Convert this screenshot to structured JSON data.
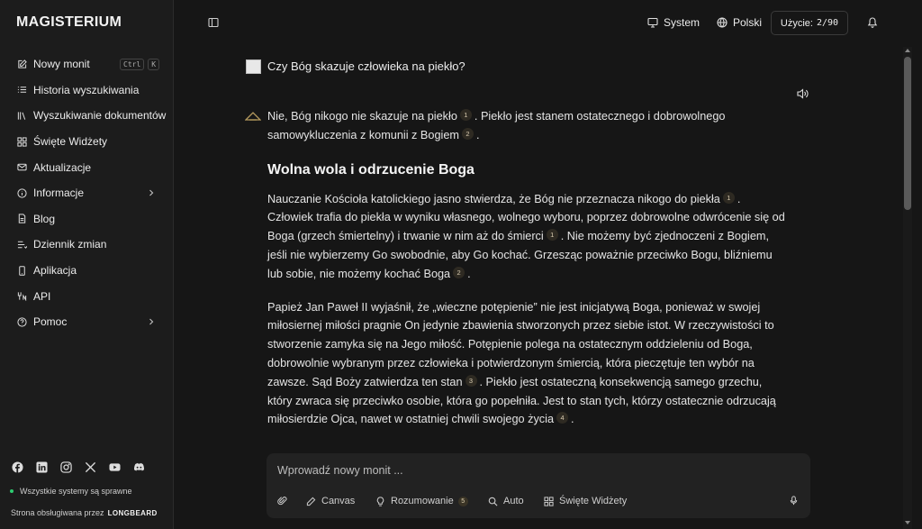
{
  "app": {
    "logo": "MAGISTERIUM"
  },
  "sidebar": {
    "items": [
      {
        "label": "Nowy monit",
        "icon": "edit-icon",
        "shortcut": [
          "Ctrl",
          "K"
        ]
      },
      {
        "label": "Historia wyszukiwania",
        "icon": "list-icon"
      },
      {
        "label": "Wyszukiwanie dokumentów",
        "icon": "library-icon"
      },
      {
        "label": "Święte Widżety",
        "icon": "grid-icon"
      },
      {
        "label": "Aktualizacje",
        "icon": "mail-icon"
      },
      {
        "label": "Informacje",
        "icon": "info-icon",
        "expandable": true
      },
      {
        "label": "Blog",
        "icon": "document-icon"
      },
      {
        "label": "Dziennik zmian",
        "icon": "changelog-icon"
      },
      {
        "label": "Aplikacja",
        "icon": "phone-icon"
      },
      {
        "label": "API",
        "icon": "api-icon"
      },
      {
        "label": "Pomoc",
        "icon": "help-icon",
        "expandable": true
      }
    ],
    "social": [
      "facebook-icon",
      "linkedin-icon",
      "instagram-icon",
      "x-icon",
      "youtube-icon",
      "discord-icon"
    ],
    "status": "Wszystkie systemy są sprawne",
    "powered_prefix": "Strona obsługiwana przez",
    "powered_brand": "LONGBEARD"
  },
  "header": {
    "theme": "System",
    "language": "Polski",
    "usage_label": "Użycie:",
    "usage_value": "2/90"
  },
  "chat": {
    "question": "Czy Bóg skazuje człowieka na piekło?",
    "answer": {
      "intro": [
        "Nie, Bóg nikogo nie skazuje na piekło",
        "1",
        ". Piekło jest stanem ostatecznego i dobrowolnego samowykluczenia z komunii z Bogiem",
        "2",
        "."
      ],
      "heading": "Wolna wola i odrzucenie Boga",
      "p1": [
        "Nauczanie Kościoła katolickiego jasno stwierdza, że Bóg nie przeznacza nikogo do piekła",
        "1",
        ". Człowiek trafia do piekła w wyniku własnego, wolnego wyboru, poprzez dobrowolne odwrócenie się od Boga (grzech śmiertelny) i trwanie w nim aż do śmierci",
        "1",
        ". Nie możemy być zjednoczeni z Bogiem, jeśli nie wybierzemy Go swobodnie, aby Go kochać. Grzesząc poważnie przeciwko Bogu, bliźniemu lub sobie, nie możemy kochać Boga",
        "2",
        "."
      ],
      "p2": [
        "Papież Jan Paweł II wyjaśnił, że „wieczne potępienie” nie jest inicjatywą Boga, ponieważ w swojej miłosiernej miłości pragnie On jedynie zbawienia stworzonych przez siebie istot. W rzeczywistości to stworzenie zamyka się na Jego miłość. Potępienie polega na ostatecznym oddzieleniu od Boga, dobrowolnie wybranym przez człowieka i potwierdzonym śmiercią, która pieczętuje ten wybór na zawsze. Sąd Boży zatwierdza ten stan",
        "3",
        ". Piekło jest ostateczną konsekwencją samego grzechu, który zwraca się przeciwko osobie, która go popełniła. Jest to stan tych, którzy ostatecznie odrzucają miłosierdzie Ojca, nawet w ostatniej chwili swojego życia",
        "4",
        "."
      ]
    }
  },
  "composer": {
    "placeholder": "Wprowadź nowy monit ...",
    "tools": {
      "canvas": "Canvas",
      "reasoning": "Rozumowanie",
      "reasoning_count": "5",
      "auto": "Auto",
      "widgets": "Święte Widżety"
    }
  }
}
